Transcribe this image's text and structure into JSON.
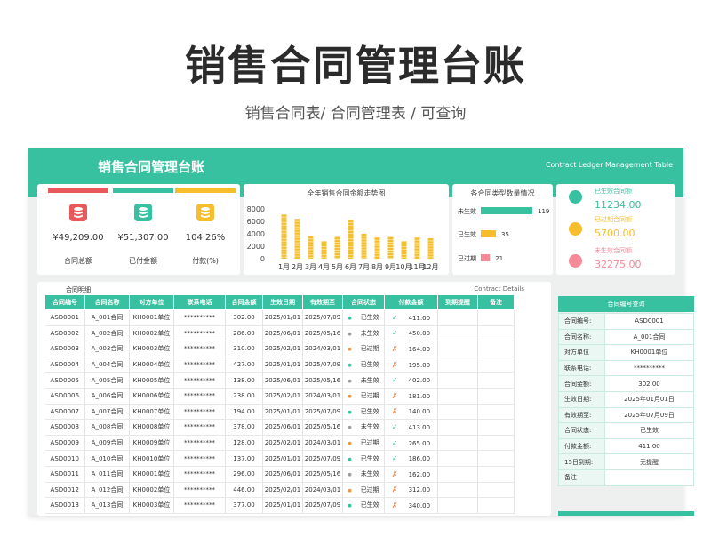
{
  "page": {
    "title": "销售合同管理台账",
    "subtitle": "销售合同表/ 合同管理表 / 可查询"
  },
  "banner": {
    "title": "销售合同管理台账",
    "subtitle_en": "Contract Ledger Management Table"
  },
  "colors": {
    "accent": "#37c1a0",
    "red": "#e9595b",
    "yellow": "#f6bd2d",
    "pink": "#f48a98"
  },
  "kpis": [
    {
      "value": "¥49,209.00",
      "label": "合同总额",
      "icon": "database-icon",
      "color": "#e9595b"
    },
    {
      "value": "¥51,307.00",
      "label": "已付金额",
      "icon": "database-icon",
      "color": "#37c1a0"
    },
    {
      "value": "104.26%",
      "label": "付款(%)",
      "icon": "database-icon",
      "color": "#f6bd2d"
    }
  ],
  "chart_data": [
    {
      "type": "bar",
      "title": "全年销售合同金额走势图",
      "categories": [
        "1月",
        "2月",
        "3月",
        "4月",
        "5月",
        "6月",
        "7月",
        "8月",
        "9月",
        "10月",
        "11月",
        "12月"
      ],
      "values": [
        7100,
        6400,
        3600,
        2800,
        3500,
        6200,
        4000,
        3400,
        3500,
        2800,
        3400,
        3300
      ],
      "ylim": [
        0,
        8000
      ],
      "yticks": [
        "8000",
        "6000",
        "4000",
        "2000",
        "0"
      ],
      "color": "#f6bd2d"
    },
    {
      "type": "bar",
      "title": "各合同类型数量情况",
      "orientation": "horizontal",
      "categories": [
        "未生效",
        "已生效",
        "已过期"
      ],
      "values": [
        119,
        35,
        21
      ],
      "colors": [
        "#37c1a0",
        "#f6bd2d",
        "#f48a98"
      ]
    }
  ],
  "status_legend": [
    {
      "label": "已生效合同额",
      "value": "11234.00",
      "color": "#37c1a0"
    },
    {
      "label": "已过期合同额",
      "value": "5700.00",
      "color": "#f6bd2d"
    },
    {
      "label": "未生效合同额",
      "value": "32275.00",
      "color": "#f48a98"
    }
  ],
  "details": {
    "title": "合同明细",
    "title_en": "Contract Details",
    "columns": [
      "合同编号",
      "合同名称",
      "对方单位",
      "联系电话",
      "合同金额",
      "生效日期",
      "有效期至",
      "合同状态",
      "付款金额",
      "到期提醒",
      "备注"
    ],
    "rows": [
      [
        "ASD0001",
        "A_001合同",
        "KH0001单位",
        "**********",
        "302.00",
        "2025/01/01",
        "2025/07/09",
        "已生效",
        "411.00",
        "",
        ""
      ],
      [
        "ASD0002",
        "A_002合同",
        "KH0002单位",
        "**********",
        "286.00",
        "2025/06/01",
        "2025/05/16",
        "未生效",
        "450.00",
        "",
        ""
      ],
      [
        "ASD0003",
        "A_003合同",
        "KH0003单位",
        "**********",
        "310.00",
        "2025/02/01",
        "2024/03/01",
        "已过期",
        "164.00",
        "",
        ""
      ],
      [
        "ASD0004",
        "A_004合同",
        "KH0004单位",
        "**********",
        "427.00",
        "2025/01/01",
        "2025/07/09",
        "已生效",
        "195.00",
        "",
        ""
      ],
      [
        "ASD0005",
        "A_005合同",
        "KH0005单位",
        "**********",
        "138.00",
        "2025/06/01",
        "2025/05/16",
        "未生效",
        "402.00",
        "",
        ""
      ],
      [
        "ASD0006",
        "A_006合同",
        "KH0006单位",
        "**********",
        "238.00",
        "2025/02/01",
        "2024/03/01",
        "已过期",
        "181.00",
        "",
        ""
      ],
      [
        "ASD0007",
        "A_007合同",
        "KH0007单位",
        "**********",
        "194.00",
        "2025/01/01",
        "2025/07/09",
        "已生效",
        "140.00",
        "",
        ""
      ],
      [
        "ASD0008",
        "A_008合同",
        "KH0008单位",
        "**********",
        "378.00",
        "2025/06/01",
        "2025/05/16",
        "未生效",
        "413.00",
        "",
        ""
      ],
      [
        "ASD0009",
        "A_009合同",
        "KH0009单位",
        "**********",
        "128.00",
        "2025/02/01",
        "2024/03/01",
        "已过期",
        "265.00",
        "",
        ""
      ],
      [
        "ASD0010",
        "A_010合同",
        "KH0010单位",
        "**********",
        "137.00",
        "2025/01/01",
        "2025/07/09",
        "已生效",
        "186.00",
        "",
        ""
      ],
      [
        "ASD0011",
        "A_011合同",
        "KH0001单位",
        "**********",
        "296.00",
        "2025/06/01",
        "2025/05/16",
        "未生效",
        "162.00",
        "",
        ""
      ],
      [
        "ASD0012",
        "A_012合同",
        "KH0002单位",
        "**********",
        "446.00",
        "2025/02/01",
        "2024/03/01",
        "已过期",
        "312.00",
        "",
        ""
      ],
      [
        "ASD0013",
        "A_013合同",
        "KH0003单位",
        "**********",
        "377.00",
        "2025/01/01",
        "2025/07/09",
        "已生效",
        "340.00",
        "",
        ""
      ]
    ],
    "payment_marks": [
      "check",
      "check",
      "cross",
      "cross",
      "check",
      "cross",
      "cross",
      "check",
      "check",
      "check",
      "cross",
      "cross",
      "cross"
    ]
  },
  "query": {
    "title": "合同编号查询",
    "fields": [
      {
        "key": "合同编号:",
        "value": "ASD0001"
      },
      {
        "key": "合同名称:",
        "value": "A_001合同"
      },
      {
        "key": "对方单位",
        "value": "KH0001单位"
      },
      {
        "key": "联系电话:",
        "value": "**********"
      },
      {
        "key": "合同金额:",
        "value": "302.00"
      },
      {
        "key": "生效日期:",
        "value": "2025年01月01日"
      },
      {
        "key": "有效期至:",
        "value": "2025年07月09日"
      },
      {
        "key": "合同状态:",
        "value": "已生效"
      },
      {
        "key": "付款金额:",
        "value": "411.00"
      },
      {
        "key": "15日到期:",
        "value": "无提醒"
      },
      {
        "key": "备注",
        "value": ""
      }
    ]
  }
}
